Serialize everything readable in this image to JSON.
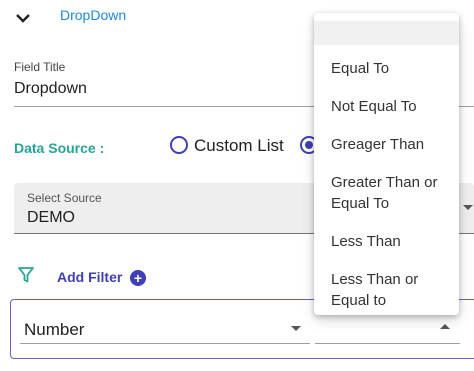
{
  "header": {
    "title": "DropDown",
    "chevron_icon": "chevron-down-icon"
  },
  "field": {
    "label": "Field Title",
    "value": "Dropdown"
  },
  "data_source": {
    "label": "Data Source :",
    "option_custom": "Custom List",
    "selected_option": "second"
  },
  "select_source": {
    "label": "Select Source",
    "value": "DEMO"
  },
  "filter": {
    "add_label": "Add Filter",
    "filter_icon": "filter-icon",
    "plus_icon": "plus-circle-icon",
    "field_value": "Number"
  },
  "operator_menu": {
    "items": [
      "Equal To",
      "Not Equal To",
      "Greager Than",
      "Greater Than or Equal To",
      "Less Than",
      "Less Than or Equal to"
    ]
  },
  "colors": {
    "accent": "#3f3fb6",
    "teal": "#26a69a",
    "title_blue": "#1e88e5",
    "panel_border": "#7e57c2"
  }
}
